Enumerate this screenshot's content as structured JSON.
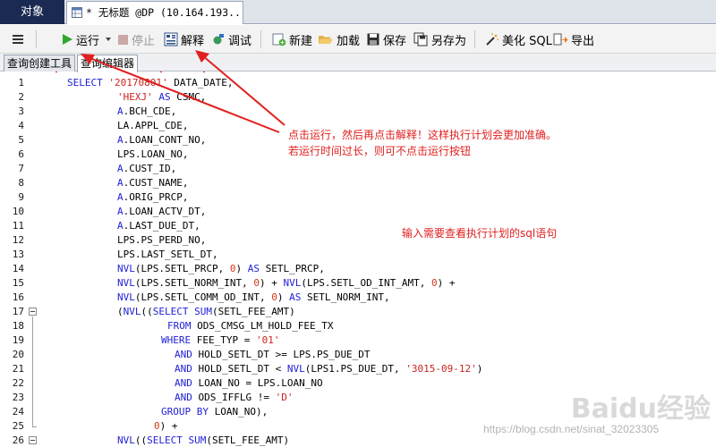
{
  "tabs": {
    "objects": "对象",
    "query_prefix": "* ",
    "query_title": "无标题",
    "query_conn": " @DP (10.164.193...."
  },
  "toolbar": {
    "run": "运行",
    "stop": "停止",
    "explain": "解释",
    "debug": "调试",
    "new": "新建",
    "load": "加载",
    "save": "保存",
    "save_as": "另存为",
    "beautify": "美化 SQL",
    "export": "导出"
  },
  "subtabs": {
    "builder": "查询创建工具",
    "editor": "查询编辑器"
  },
  "code_lines": [
    "1",
    "2",
    "3",
    "4",
    "5",
    "6",
    "7",
    "8",
    "9",
    "10",
    "11",
    "12",
    "13",
    "14",
    "15",
    "16",
    "17",
    "18",
    "19",
    "20",
    "21",
    "22",
    "23",
    "24",
    "25",
    "26"
  ],
  "code": [
    [
      [
        "kw",
        "SELECT"
      ],
      [
        "t",
        " "
      ],
      [
        "str",
        "'20170801'"
      ],
      [
        "t",
        " DATA_DATE,"
      ]
    ],
    [
      [
        "str",
        "'HEXJ'"
      ],
      [
        "t",
        " "
      ],
      [
        "kw",
        "AS"
      ],
      [
        "t",
        " CSMC,"
      ]
    ],
    [
      [
        "kw",
        "A"
      ],
      [
        "t",
        ".BCH_CDE,"
      ]
    ],
    [
      [
        "t",
        "LA.APPL_CDE,"
      ]
    ],
    [
      [
        "kw",
        "A"
      ],
      [
        "t",
        ".LOAN_CONT_NO,"
      ]
    ],
    [
      [
        "t",
        "LPS.LOAN_NO,"
      ]
    ],
    [
      [
        "kw",
        "A"
      ],
      [
        "t",
        ".CUST_ID,"
      ]
    ],
    [
      [
        "kw",
        "A"
      ],
      [
        "t",
        ".CUST_NAME,"
      ]
    ],
    [
      [
        "kw",
        "A"
      ],
      [
        "t",
        ".ORIG_PRCP,"
      ]
    ],
    [
      [
        "kw",
        "A"
      ],
      [
        "t",
        ".LOAN_ACTV_DT,"
      ]
    ],
    [
      [
        "kw",
        "A"
      ],
      [
        "t",
        ".LAST_DUE_DT,"
      ]
    ],
    [
      [
        "t",
        "LPS.PS_PERD_NO,"
      ]
    ],
    [
      [
        "t",
        "LPS.LAST_SETL_DT,"
      ]
    ],
    [
      [
        "kw",
        "NVL"
      ],
      [
        "t",
        "(LPS.SETL_PRCP, "
      ],
      [
        "num",
        "0"
      ],
      [
        "t",
        ") "
      ],
      [
        "kw",
        "AS"
      ],
      [
        "t",
        " SETL_PRCP,"
      ]
    ],
    [
      [
        "kw",
        "NVL"
      ],
      [
        "t",
        "(LPS.SETL_NORM_INT, "
      ],
      [
        "num",
        "0"
      ],
      [
        "t",
        ") + "
      ],
      [
        "kw",
        "NVL"
      ],
      [
        "t",
        "(LPS.SETL_OD_INT_AMT, "
      ],
      [
        "num",
        "0"
      ],
      [
        "t",
        ") +"
      ]
    ],
    [
      [
        "kw",
        "NVL"
      ],
      [
        "t",
        "(LPS.SETL_COMM_OD_INT, "
      ],
      [
        "num",
        "0"
      ],
      [
        "t",
        ") "
      ],
      [
        "kw",
        "AS"
      ],
      [
        "t",
        " SETL_NORM_INT,"
      ]
    ],
    [
      [
        "t",
        "("
      ],
      [
        "kw",
        "NVL"
      ],
      [
        "t",
        "(("
      ],
      [
        "kw",
        "SELECT"
      ],
      [
        "t",
        " "
      ],
      [
        "kw",
        "SUM"
      ],
      [
        "t",
        "(SETL_FEE_AMT)"
      ]
    ],
    [
      [
        "kw",
        "FROM"
      ],
      [
        "t",
        " ODS_CMSG_LM_HOLD_FEE_TX"
      ]
    ],
    [
      [
        "kw",
        "WHERE"
      ],
      [
        "t",
        " FEE_TYP = "
      ],
      [
        "str",
        "'01'"
      ]
    ],
    [
      [
        "kw",
        "AND"
      ],
      [
        "t",
        " HOLD_SETL_DT >= LPS.PS_DUE_DT"
      ]
    ],
    [
      [
        "kw",
        "AND"
      ],
      [
        "t",
        " HOLD_SETL_DT < "
      ],
      [
        "kw",
        "NVL"
      ],
      [
        "t",
        "(LPS1.PS_DUE_DT, "
      ],
      [
        "str",
        "'3015-09-12'"
      ],
      [
        "t",
        ")"
      ]
    ],
    [
      [
        "kw",
        "AND"
      ],
      [
        "t",
        " LOAN_NO = LPS.LOAN_NO"
      ]
    ],
    [
      [
        "kw",
        "AND"
      ],
      [
        "t",
        " ODS_IFFLG != "
      ],
      [
        "str",
        "'D'"
      ]
    ],
    [
      [
        "kw",
        "GROUP BY"
      ],
      [
        "t",
        " LOAN_NO),"
      ]
    ],
    [
      [
        "num",
        "0"
      ],
      [
        "t",
        ") +"
      ]
    ],
    [
      [
        "kw",
        "NVL"
      ],
      [
        "t",
        "(("
      ],
      [
        "kw",
        "SELECT"
      ],
      [
        "t",
        " "
      ],
      [
        "kw",
        "SUM"
      ],
      [
        "t",
        "(SETL_FEE_AMT)"
      ]
    ]
  ],
  "annotations": {
    "run_hint_1": "点击运行，然后再点击解释！这样执行计划会更加准确。",
    "run_hint_2": "若运行时间过长，则可不点击运行按钮",
    "sql_hint": "输入需要查看执行计划的sql语句"
  },
  "watermark": {
    "brand": "Baidu经验",
    "url": "https://blog.csdn.net/sinat_32023305"
  },
  "colors": {
    "keyword": "#1f1fd6",
    "string": "#c8241f",
    "number": "#d6381f",
    "annotation": "#e02020",
    "objects_tab": "#1b2a52",
    "run_icon": "#2ea82e"
  },
  "icons": {
    "menu": "hamburger-icon",
    "run": "play-icon",
    "dropdown": "caret-down-icon",
    "stop": "stop-icon",
    "explain": "explain-plan-icon",
    "debug": "debug-icon",
    "new": "new-query-icon",
    "load": "folder-open-icon",
    "save": "save-icon",
    "save_as": "save-as-icon",
    "beautify": "magic-wand-icon",
    "export": "export-icon"
  }
}
